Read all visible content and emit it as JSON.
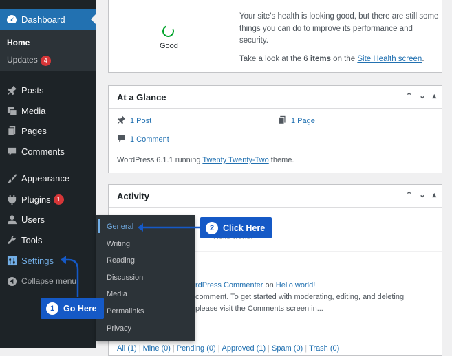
{
  "sidebar": {
    "dashboard": "Dashboard",
    "home": "Home",
    "updates": "Updates",
    "updates_count": "4",
    "items": {
      "posts": "Posts",
      "media": "Media",
      "pages": "Pages",
      "comments": "Comments",
      "appearance": "Appearance",
      "plugins": "Plugins",
      "plugins_count": "1",
      "users": "Users",
      "tools": "Tools",
      "settings": "Settings",
      "collapse": "Collapse menu"
    }
  },
  "settings_flyout": {
    "items": [
      "General",
      "Writing",
      "Reading",
      "Discussion",
      "Media",
      "Permalinks",
      "Privacy"
    ]
  },
  "site_health": {
    "status": "Good",
    "text": "Your site's health is looking good, but there are still some things you can do to improve its performance and security.",
    "more_prefix": "Take a look at the ",
    "more_count": "6 items",
    "more_mid": " on the ",
    "more_link": "Site Health screen",
    "more_suffix": "."
  },
  "at_a_glance": {
    "title": "At a Glance",
    "posts": "1 Post",
    "pages": "1 Page",
    "comments": "1 Comment",
    "footer_prefix": "WordPress 6.1.1 running ",
    "theme_link": "Twenty Twenty-Two",
    "footer_suffix": " theme."
  },
  "activity": {
    "title": "Activity",
    "recent_fragment": "Hello world!",
    "comment_author_fragment": "rdPress Commenter",
    "comment_on": " on ",
    "comment_post": "Hello world!",
    "comment_line2": "comment. To get started with moderating, editing, and deleting",
    "comment_line3": "please visit the Comments screen in...",
    "filters": [
      "All (1)",
      "Mine (0)",
      "Pending (0)",
      "Approved (1)",
      "Spam (0)",
      "Trash (0)"
    ]
  },
  "callouts": {
    "one_num": "1",
    "one_label": "Go Here",
    "two_num": "2",
    "two_label": "Click Here"
  },
  "colors": {
    "sidebar_bg": "#1d2327",
    "accent": "#2271b1",
    "callout": "#1559c6",
    "badge": "#d63638",
    "health_good": "#00a32a"
  }
}
